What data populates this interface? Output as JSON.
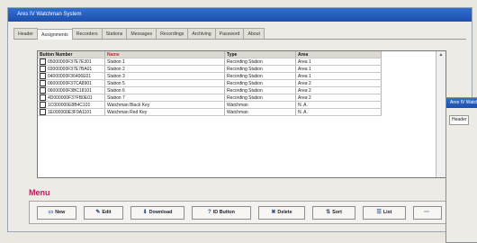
{
  "window": {
    "title": "Ares IV Watchman System"
  },
  "tabs": [
    "Header",
    "Assignments",
    "Recorders",
    "Stations",
    "Messages",
    "Recordings",
    "Archiving",
    "Password",
    "About"
  ],
  "table": {
    "headers": [
      "Button Number",
      "Name",
      "Type",
      "Area"
    ],
    "rows": [
      {
        "id": "05000000F37E7E301",
        "name": "Station 1",
        "type": "Recording Station",
        "area": "Area 1",
        "checked": false
      },
      {
        "id": "03000000F37E7BA01",
        "name": "Station 2",
        "type": "Recording Station",
        "area": "Area 1",
        "checked": false
      },
      {
        "id": "04000000F36406E01",
        "name": "Station 3",
        "type": "Recording Station",
        "area": "Area 1",
        "checked": false
      },
      {
        "id": "06000000F37CA8901",
        "name": "Station 5",
        "type": "Recording Station",
        "area": "Area 2",
        "checked": false
      },
      {
        "id": "06000000F3BC18101",
        "name": "Station 6",
        "type": "Recording Station",
        "area": "Area 2",
        "checked": false
      },
      {
        "id": "4D000000F37FB0E01",
        "name": "Station 7",
        "type": "Recording Station",
        "area": "Area 2",
        "checked": false
      },
      {
        "id": "1C000000E8B4C101",
        "name": "Watchman Black Key",
        "type": "Watchman",
        "area": "N. A.",
        "checked": true
      },
      {
        "id": "1E000000E3F9A1101",
        "name": "Watchman Red Key",
        "type": "Watchman",
        "area": "N. A.",
        "checked": false
      }
    ]
  },
  "menu": {
    "label": "Menu",
    "buttons": [
      {
        "label": "New",
        "icon": "new-document-icon"
      },
      {
        "label": "Edit",
        "icon": "edit-icon"
      },
      {
        "label": "Download",
        "icon": "download-icon"
      },
      {
        "label": "ID Button",
        "icon": "id-button-icon"
      },
      {
        "label": "Delete",
        "icon": "delete-icon"
      },
      {
        "label": "Sort",
        "icon": "sort-icon"
      },
      {
        "label": "List",
        "icon": "list-icon"
      }
    ]
  },
  "second_window": {
    "title": "Ares IV Watchman",
    "tab": "Header"
  },
  "colors": {
    "titlebar": "#2f6fd0",
    "accent": "#cc2b2b",
    "menu_label": "#c2185b"
  }
}
